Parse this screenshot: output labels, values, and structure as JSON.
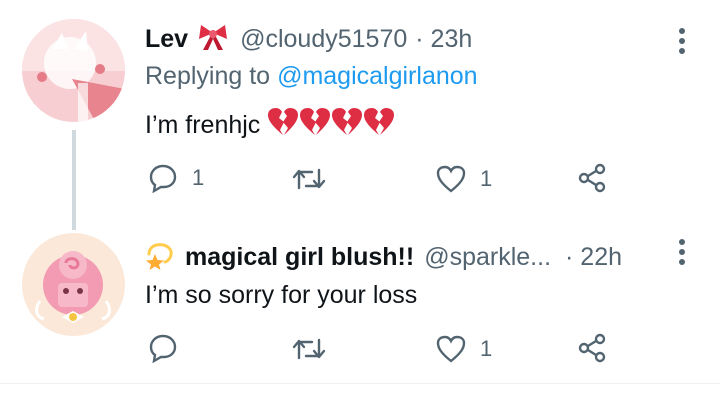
{
  "tweets": [
    {
      "name": "Lev",
      "name_emoji": "ribbon-icon",
      "handle": "@cloudy51570",
      "time": "· 23h",
      "replying_label": "Replying to",
      "replying_handle": "@magicalgirlanon",
      "text": "I’m frenhjc",
      "text_emojis": [
        "broken-heart-icon",
        "broken-heart-icon",
        "broken-heart-icon",
        "broken-heart-icon"
      ],
      "actions": {
        "reply_count": "1",
        "retweet_count": "",
        "like_count": "1"
      }
    },
    {
      "name_emoji": "dizzy-star-icon",
      "name": "magical girl blush!!",
      "handle": "@sparkle...",
      "time": "· 22h",
      "text": "I’m so sorry for your loss",
      "actions": {
        "reply_count": "",
        "retweet_count": "",
        "like_count": "1"
      }
    }
  ],
  "colors": {
    "accent": "#1d9bf0",
    "secondary_text": "#536471",
    "primary_text": "#0f1419",
    "broken_heart": "#dd2e44",
    "thread_line": "#cfd9de"
  }
}
